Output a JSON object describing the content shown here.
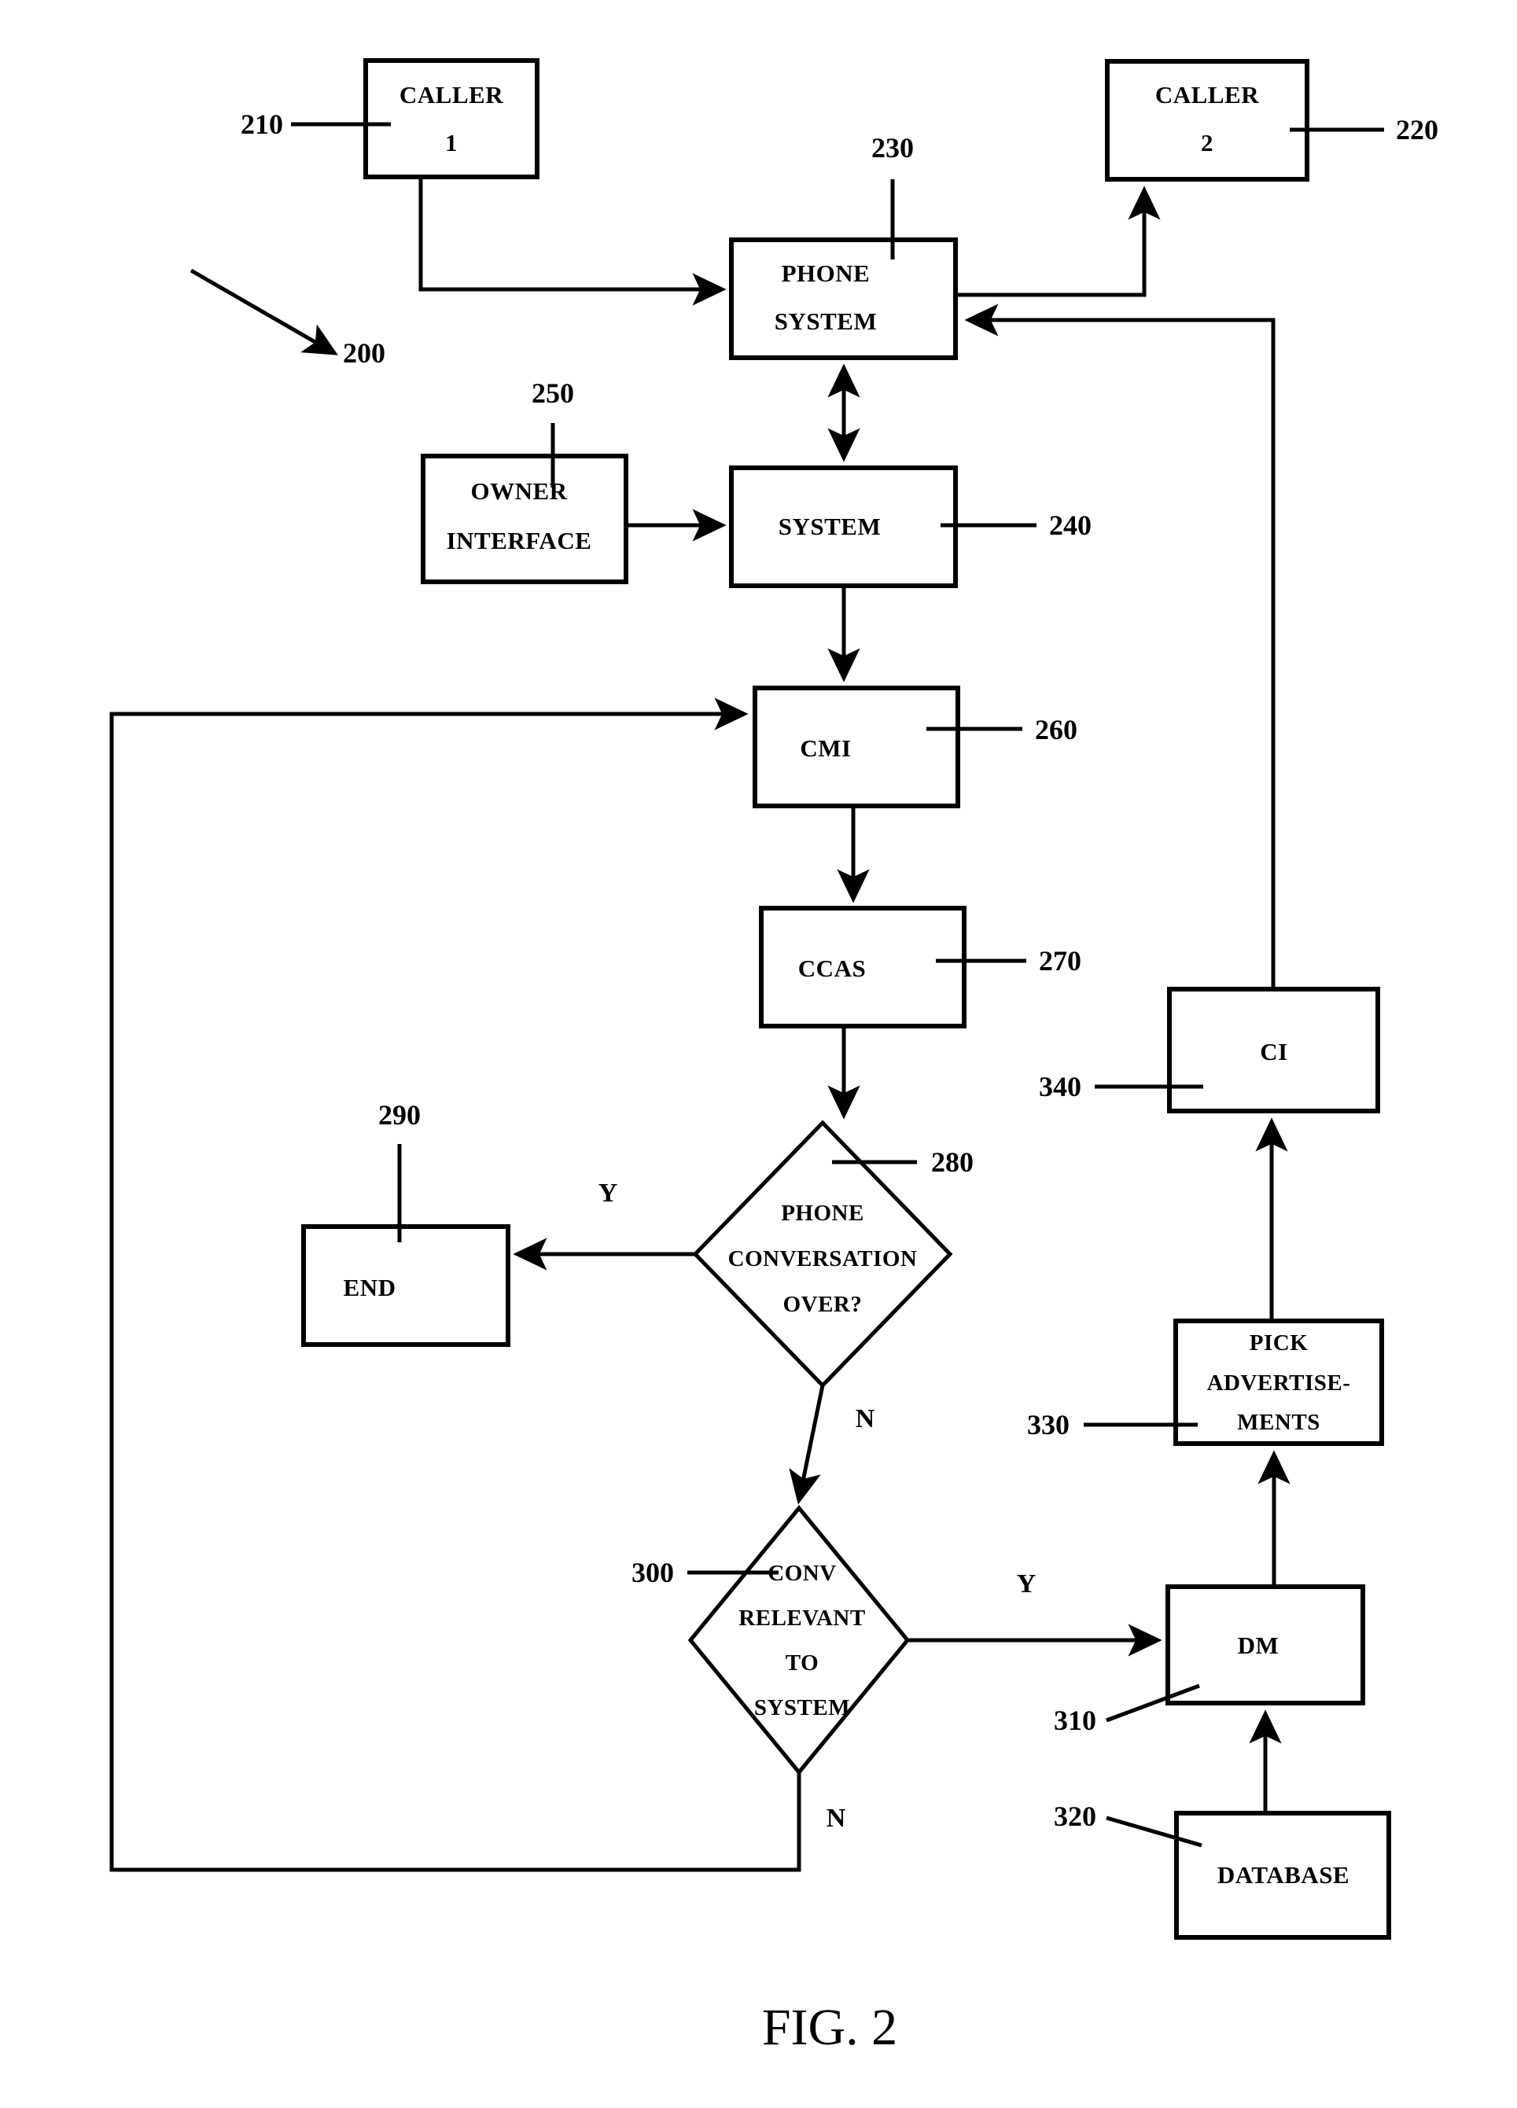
{
  "figure": {
    "caption": "FIG. 2",
    "overall_ref": "200"
  },
  "nodes": {
    "caller1": {
      "label_line1": "CALLER",
      "label_line2": "1",
      "ref": "210"
    },
    "caller2": {
      "label_line1": "CALLER",
      "label_line2": "2",
      "ref": "220"
    },
    "phone_system": {
      "label_line1": "PHONE",
      "label_line2": "SYSTEM",
      "ref": "230"
    },
    "system": {
      "label_line1": "SYSTEM",
      "ref": "240"
    },
    "owner_interface": {
      "label_line1": "OWNER",
      "label_line2": "INTERFACE",
      "ref": "250"
    },
    "cmi": {
      "label_line1": "CMI",
      "ref": "260"
    },
    "ccas": {
      "label_line1": "CCAS",
      "ref": "270"
    },
    "conversation_over": {
      "label_line1": "PHONE",
      "label_line2": "CONVERSATION",
      "label_line3": "OVER?",
      "ref": "280"
    },
    "end": {
      "label_line1": "END",
      "ref": "290"
    },
    "conv_relevant": {
      "label_line1": "CONV",
      "label_line2": "RELEVANT",
      "label_line3": "TO",
      "label_line4": "SYSTEM",
      "ref": "300"
    },
    "dm": {
      "label_line1": "DM",
      "ref": "310"
    },
    "database": {
      "label_line1": "DATABASE",
      "ref": "320"
    },
    "pick_advertisements": {
      "label_line1": "PICK",
      "label_line2": "ADVERTISE-",
      "label_line3": "MENTS",
      "ref": "330"
    },
    "ci": {
      "label_line1": "CI",
      "ref": "340"
    }
  },
  "branches": {
    "conversation_over_yes": "Y",
    "conversation_over_no": "N",
    "conv_relevant_yes": "Y",
    "conv_relevant_no": "N"
  },
  "colors": {
    "ink": "#000000",
    "paper": "#ffffff"
  }
}
